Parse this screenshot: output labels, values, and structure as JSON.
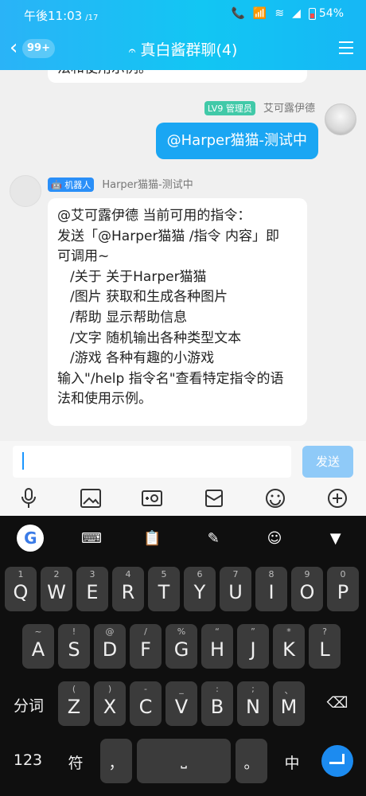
{
  "status": {
    "time": "午後11:03",
    "date": "/17",
    "battery": "54%"
  },
  "header": {
    "badge": "99+",
    "title": "真白酱群聊(4)"
  },
  "chat": {
    "prev_text": "法和使用示例。",
    "right_sender": {
      "level": "LV9",
      "role": "管理员",
      "name": "艾可露伊德"
    },
    "right_message": "@Harper猫猫-测试中",
    "left_sender": {
      "tag": "机器人",
      "name": "Harper猫猫-测试中"
    },
    "left_message_lines": [
      "@艾可露伊德 当前可用的指令：",
      "发送「@Harper猫猫 /指令 内容」即",
      "可调用~",
      "/关于  关于Harper猫猫",
      "/图片  获取和生成各种图片",
      "/帮助  显示帮助信息",
      "/文字  随机输出各种类型文本",
      "/游戏  各种有趣的小游戏",
      "输入\"/help 指令名\"查看特定指令的语",
      "法和使用示例。"
    ]
  },
  "input": {
    "value": "",
    "placeholder": "",
    "send_label": "发送",
    "toolbar_icons": [
      "microphone-icon",
      "image-icon",
      "camera-icon",
      "red-envelope-icon",
      "emoji-icon",
      "plus-icon"
    ]
  },
  "keyboard": {
    "top_icons": [
      "google-icon",
      "keyboard-icon",
      "clipboard-icon",
      "edit-icon",
      "emoji-icon",
      "hide-keyboard-icon"
    ],
    "row1": [
      {
        "k": "Q",
        "a": "1"
      },
      {
        "k": "W",
        "a": "2"
      },
      {
        "k": "E",
        "a": "3"
      },
      {
        "k": "R",
        "a": "4"
      },
      {
        "k": "T",
        "a": "5"
      },
      {
        "k": "Y",
        "a": "6"
      },
      {
        "k": "U",
        "a": "7"
      },
      {
        "k": "I",
        "a": "8"
      },
      {
        "k": "O",
        "a": "9"
      },
      {
        "k": "P",
        "a": "0"
      }
    ],
    "row2": [
      {
        "k": "A",
        "a": "~"
      },
      {
        "k": "S",
        "a": "!"
      },
      {
        "k": "D",
        "a": "@"
      },
      {
        "k": "F",
        "a": "/"
      },
      {
        "k": "G",
        "a": "%"
      },
      {
        "k": "H",
        "a": "“"
      },
      {
        "k": "J",
        "a": "”"
      },
      {
        "k": "K",
        "a": "*"
      },
      {
        "k": "L",
        "a": "?"
      }
    ],
    "row3_left": "分词",
    "row3": [
      {
        "k": "Z",
        "a": "("
      },
      {
        "k": "X",
        "a": ")"
      },
      {
        "k": "C",
        "a": "-"
      },
      {
        "k": "V",
        "a": "_"
      },
      {
        "k": "B",
        "a": ":"
      },
      {
        "k": "N",
        "a": ";"
      },
      {
        "k": "M",
        "a": "、"
      }
    ],
    "row4": {
      "num": "123",
      "sym": "符",
      "comma": "，",
      "period": "。",
      "lang": "中"
    }
  }
}
